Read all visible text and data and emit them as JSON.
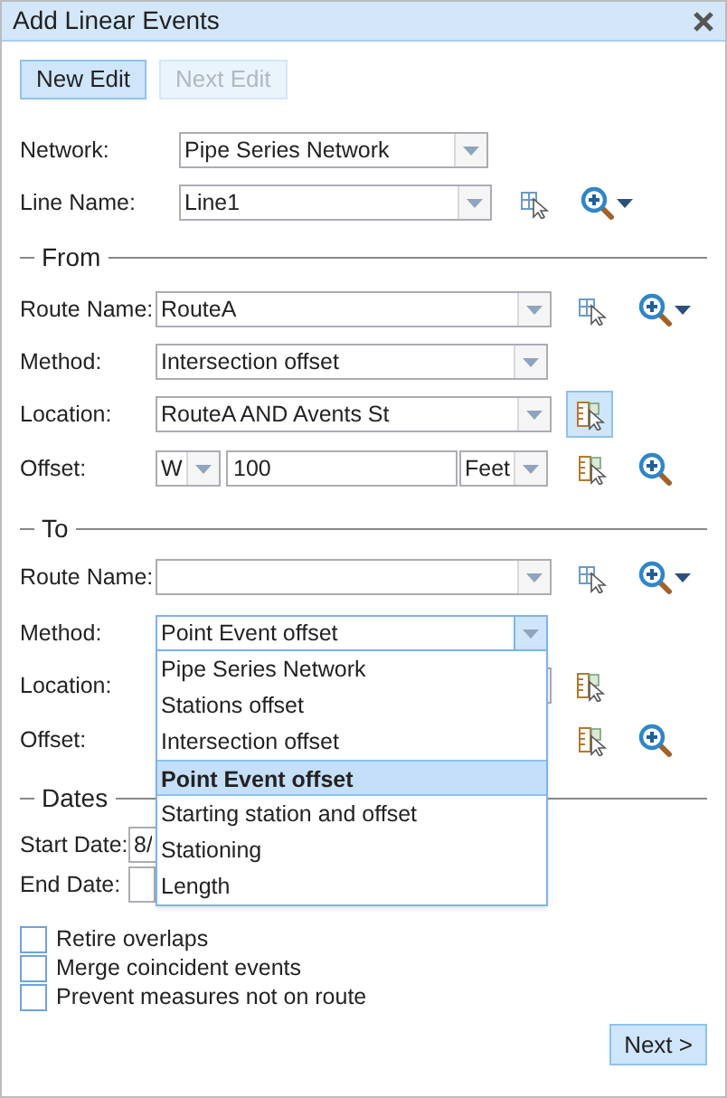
{
  "window": {
    "title": "Add Linear Events"
  },
  "edit_buttons": [
    {
      "label": "New Edit",
      "disabled": false
    },
    {
      "label": "Next Edit",
      "disabled": true
    }
  ],
  "network": {
    "label": "Network:",
    "value": "Pipe Series Network"
  },
  "line_name": {
    "label": "Line Name:",
    "value": "Line1"
  },
  "from": {
    "legend": "From",
    "route_name": {
      "label": "Route Name:",
      "value": "RouteA"
    },
    "method": {
      "label": "Method:",
      "value": "Intersection offset",
      "expanded": false
    },
    "location": {
      "label": "Location:",
      "value": "RouteA AND Avents St",
      "pick_active": true
    },
    "offset": {
      "label": "Offset:",
      "direction": "W",
      "distance": "100",
      "units": "Feet"
    }
  },
  "to": {
    "legend": "To",
    "route_name": {
      "label": "Route Name:"
    },
    "method": {
      "label": "Method:",
      "value": "Point Event offset",
      "expanded": true,
      "options": [
        {
          "label": "Pipe Series Network",
          "selected": false
        },
        {
          "label": "Stations offset",
          "selected": false
        },
        {
          "label": "Intersection offset",
          "selected": false
        },
        {
          "label": "Point Event offset",
          "selected": true
        },
        {
          "label": "Starting station and offset",
          "selected": false
        },
        {
          "label": "Stationing",
          "selected": false
        },
        {
          "label": "Length",
          "selected": false
        }
      ]
    },
    "location": {
      "label": "Location:",
      "pick_active": false
    },
    "offset": {
      "label": "Offset:"
    }
  },
  "dates": {
    "legend": "Dates",
    "start_date": {
      "label": "Start Date:",
      "value": "8/"
    },
    "end_date": {
      "label": "End Date:"
    }
  },
  "options": [
    {
      "label": "Retire overlaps",
      "checked": false
    },
    {
      "label": "Merge coincident events",
      "checked": false
    },
    {
      "label": "Prevent measures not on route",
      "checked": false
    }
  ],
  "next_button": "Next >"
}
